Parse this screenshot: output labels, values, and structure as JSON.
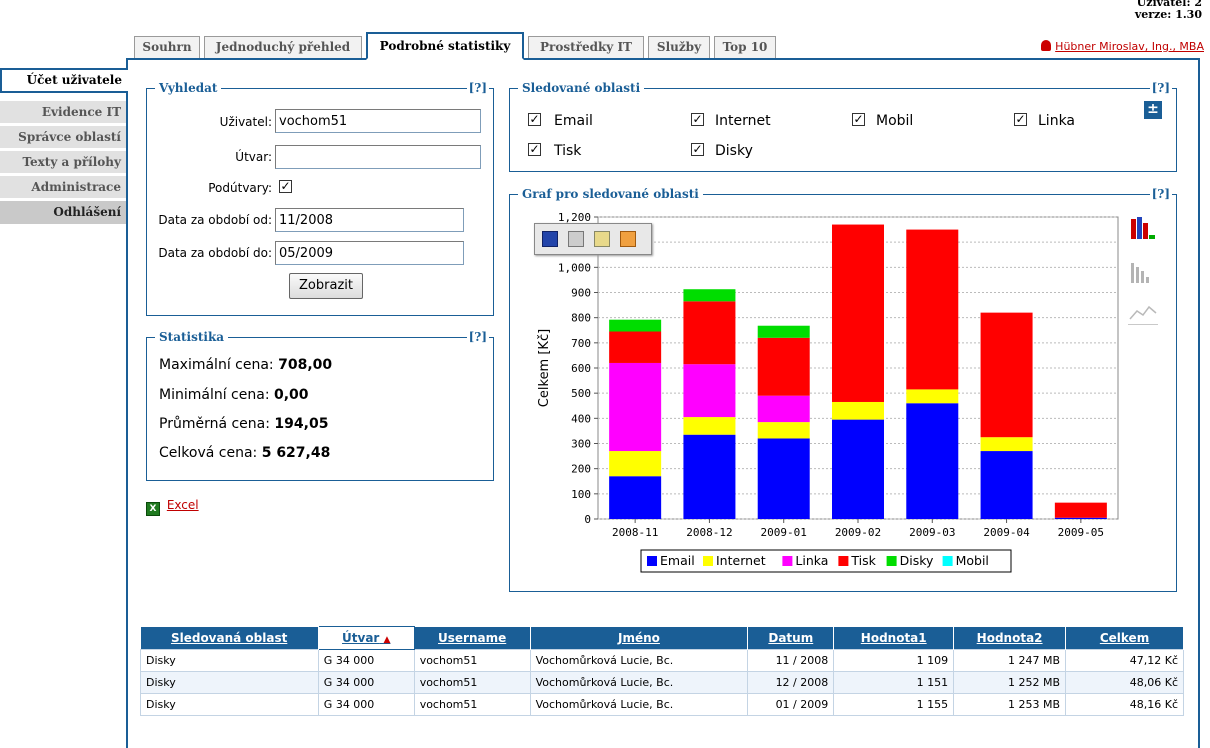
{
  "header": {
    "user_id": "Uživatel: 2",
    "version": "verze: 1.30",
    "user_name": "Hübner Miroslav, Ing., MBA"
  },
  "tabs": [
    "Souhrn",
    "Jednoduchý přehled",
    "Podrobné statistiky",
    "Prostředky IT",
    "Služby",
    "Top 10"
  ],
  "active_tab": "Podrobné statistiky",
  "sidebar": {
    "items": [
      "Účet uživatele",
      "Evidence IT",
      "Správce oblastí",
      "Texty a přílohy",
      "Administrace",
      "Odhlášení"
    ]
  },
  "search": {
    "title": "Vyhledat",
    "help": "[?]",
    "user_label": "Uživatel:",
    "user_value": "vochom51",
    "unit_label": "Útvar:",
    "unit_value": "",
    "subunits_label": "Podútvary:",
    "subunits_checked": true,
    "from_label": "Data za období od:",
    "from_value": "11/2008",
    "to_label": "Data za období do:",
    "to_value": "05/2009",
    "submit_label": "Zobrazit"
  },
  "areas": {
    "title": "Sledované oblasti",
    "help": "[?]",
    "items": [
      {
        "label": "Email",
        "checked": true
      },
      {
        "label": "Internet",
        "checked": true
      },
      {
        "label": "Mobil",
        "checked": true
      },
      {
        "label": "Linka",
        "checked": true
      },
      {
        "label": "Tisk",
        "checked": true
      },
      {
        "label": "Disky",
        "checked": true
      }
    ]
  },
  "stats": {
    "title": "Statistika",
    "help": "[?]",
    "max_label": "Maximální cena:",
    "max_value": "708,00",
    "min_label": "Minimální cena:",
    "min_value": "0,00",
    "avg_label": "Průměrná cena:",
    "avg_value": "194,05",
    "total_label": "Celková cena:",
    "total_value": "5 627,48"
  },
  "excel": {
    "label": "Excel"
  },
  "chart_section": {
    "title": "Graf pro sledované oblasti",
    "help": "[?]"
  },
  "chart_data": {
    "type": "bar",
    "stacked": true,
    "categories": [
      "2008-11",
      "2008-12",
      "2009-01",
      "2009-02",
      "2009-03",
      "2009-04",
      "2009-05"
    ],
    "ylabel": "Celkem [Kč]",
    "ylim": [
      0,
      1200
    ],
    "yticks": [
      "0",
      "100",
      "200",
      "300",
      "400",
      "500",
      "600",
      "700",
      "800",
      "900",
      "1,000",
      "1,100",
      "1,200"
    ],
    "grid": true,
    "legend_position": "bottom",
    "series": [
      {
        "name": "Email",
        "color": "#0000ff",
        "values": [
          170,
          335,
          320,
          395,
          460,
          270,
          5
        ]
      },
      {
        "name": "Internet",
        "color": "#ffff00",
        "values": [
          100,
          70,
          65,
          70,
          55,
          55,
          0
        ]
      },
      {
        "name": "Linka",
        "color": "#ff00ff",
        "values": [
          350,
          210,
          105,
          0,
          0,
          0,
          0
        ]
      },
      {
        "name": "Tisk",
        "color": "#ff0000",
        "values": [
          125,
          250,
          230,
          705,
          635,
          495,
          60
        ]
      },
      {
        "name": "Disky",
        "color": "#00dd00",
        "values": [
          47,
          48,
          48,
          0,
          0,
          0,
          0
        ]
      },
      {
        "name": "Mobil",
        "color": "#00ffff",
        "values": [
          0,
          0,
          0,
          0,
          0,
          0,
          0
        ]
      }
    ]
  },
  "table": {
    "columns": [
      "Sledovaná oblast",
      "Útvar",
      "Username",
      "Jméno",
      "Datum",
      "Hodnota1",
      "Hodnota2",
      "Celkem"
    ],
    "rows": [
      [
        "Disky",
        "G 34 000",
        "vochom51",
        "Vochomůrková Lucie, Bc.",
        "11 / 2008",
        "1 109",
        "1 247 MB",
        "47,12 Kč"
      ],
      [
        "Disky",
        "G 34 000",
        "vochom51",
        "Vochomůrková Lucie, Bc.",
        "12 / 2008",
        "1 151",
        "1 252 MB",
        "48,06 Kč"
      ],
      [
        "Disky",
        "G 34 000",
        "vochom51",
        "Vochomůrková Lucie, Bc.",
        "01 / 2009",
        "1 155",
        "1 253 MB",
        "48,16 Kč"
      ]
    ]
  }
}
